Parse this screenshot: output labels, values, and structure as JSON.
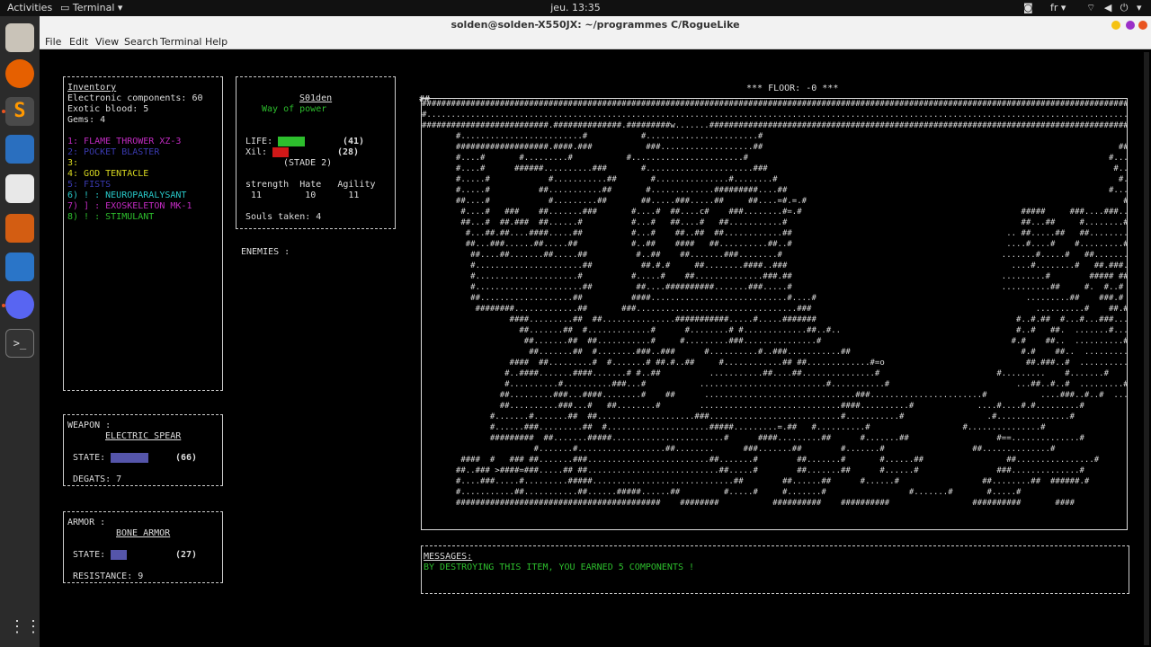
{
  "topbar": {
    "activities": "Activities",
    "app": "Terminal",
    "clock": "jeu. 13:35",
    "lang": "fr"
  },
  "window": {
    "title": "solden@solden-X550JX: ~/programmes C/RogueLike"
  },
  "menu": {
    "file": "File",
    "edit": "Edit",
    "view": "View",
    "search": "Search",
    "terminal": "Terminal",
    "help": "Help"
  },
  "inventory": {
    "title": "Inventory",
    "components": "Electronic components: 60",
    "blood": "Exotic blood: 5",
    "gems": "Gems: 4",
    "slots": [
      {
        "text": "1: FLAME THROWER XZ-3",
        "color": "#c02ac0"
      },
      {
        "text": "2: POCKET BLASTER",
        "color": "#3a3ab0"
      },
      {
        "text": "3:",
        "color": "#d8d820"
      },
      {
        "text": "4: GOD TENTACLE",
        "color": "#d8d820"
      },
      {
        "text": "5: FISTS",
        "color": "#3a3ab0"
      },
      {
        "text": "6) ! : NEUROPARALYSANT",
        "color": "#28c8c8"
      },
      {
        "text": "7) ] : EXOSKELETON MK-1",
        "color": "#c02ac0"
      },
      {
        "text": "8) ! : STIMULANT",
        "color": "#2dbe2d"
      }
    ]
  },
  "player": {
    "name": "S01den",
    "path": "Way of power",
    "life_label": "LIFE:",
    "life_value": "(41)",
    "xil_label": "Xil:",
    "xil_value": "(28)",
    "stade": "(STADE 2)",
    "stat_headers": "strength  Hate   Agility",
    "stat_values": "11        10      11",
    "souls": "Souls taken: 4",
    "enemies": "ENEMIES :",
    "colors": {
      "life": "#2dbe2d",
      "xil": "#d01818"
    }
  },
  "weapon": {
    "label": "WEAPON :",
    "name": "ELECTRIC SPEAR",
    "state_label": "STATE:",
    "state_value": "(66)",
    "degats": "DEGATS: 7",
    "bar_color": "#5555aa"
  },
  "armor": {
    "label": "ARMOR :",
    "name": "BONE ARMOR",
    "state_label": "STATE:",
    "state_value": "(27)",
    "resistance": "RESISTANCE: 9",
    "bar_color": "#5555aa"
  },
  "floor": "*** FLOOR: -0 ***",
  "map_corner": "##",
  "messages": {
    "label": "MESSAGES:",
    "text": "BY DESTROYING THIS ITEM, YOU EARNED 5 COMPONENTS !",
    "color": "#2dbe2d"
  },
  "map": [
    "##################################################################################################################################################################",
    "#.....................................................................................................................................................................#",
    "##########################.##############.#########w.......###############################################################################################.....#",
    "       #.........................#           #.......................#                                                                                       ...#",
    "       ###################.####.###           ###...................##                                                                         #####  ###...#",
    "       #....#       #.........#           #.......................#                                                                          #...#  #.....#",
    "       #....#      ######..........###       #......................###                                                                       #....#  #.....#",
    "       #.....#            #...........##       #...............#........#                                                                      #....#   #.....#",
    "       #.....#          ##...........##       #.............#########....##                                                                  #...##  ##.....#",
    "       ##....#            #.........##       ##.....###.....##     ##....=#.=.#                                                                 #....##  #.....#",
    "        #....#   ###    ##.......###       #....#  ##....c#    ###........#=.#                                             #####     ###....###...#",
    "        ##...#  ##.###  ##......#          #...#   ##....#   ##...........#                                                ##...##     #........#",
    "         #...##.##....####.....##          #...#    ##..##  ##............##                                            .. ##.....##   ##........#",
    "         ##...###......##.....##           #..##    ####   ##..........##..#                                            ....#....#    #.........#",
    "          ##....##.......##.....##          #..##    ##.......###........#                                             .......#.....#   ##.......#",
    "          #......................##          ##.#.#     ##........####..###                                              ....#........#   ##.###..#",
    "          #.....................#          #.....#    ##..............###.##                                           .........#        ##### ##",
    "          #......................##         ##....##########.......###.....#                                           ..........##     #.  #..#",
    "          ##...................##          ####............................#....#                                           .........##    ###.# #..#",
    "           ########.............##       ###.................................###                                              ..........#    ##.# ##...#",
    "                  ####.........##  ##...............###########.....#.....#######                                         #..#.##  #...#...###.....#",
    "                    ##.......##  #.............#      #........# #.............##..#..                                    #..#   ##.  .......#.......#",
    "                     ##.......##  ##...........#     #.........###...............#                                       #.#    ##..  ..........#",
    "                      ##.......##  #........###..###      #..........#..###...........##                                   #.#    ##..  ..........#",
    "                  ####  ##.........#  #.......# ##.#..##     #............## ##.............#=o                             ##.###..#  ..........#",
    "                 #..####.......####.......# #..##          ...........##....##...............#                        #.........    #.......#",
    "                 #..........#..........###...#           ..........................#...........#                          ...##..#..#  .........#",
    "                ##.........###...####........#    ##      ...............................###.......................#           ....###..#..#  ...........#",
    "                ##..........###...#   ##........#        .............................####..........#             ....#....#.#.........#",
    "              #.......#.......##  ##....................###...........................#...........#                 .#...............#",
    "              #......###.........##  #.....................#####.........=.##   #..........#                   #...............#",
    "              #########  ##.......#####.......................#      ####.........##      #.......##                  #==..............#",
    "                       #.......#..................##........      ###.......##        #.......#                  ##..............#",
    "        ####  #   ### ##.......###.........................##.......#        ##.......#       #......##                 ##................#",
    "       ##..### >####=###.....## ##...........................##.....#        ##.......##      #......#                ###..............#",
    "       #....###.....#.........#####.............................##        ##......##      #......#                 ##........##  ######.#",
    "       #...........##...........##......#####......##         #.....#     #.......#                 #.......#       #.....#",
    "       ##########################################    ########           ##########    ##########                 ##########       ####"
  ]
}
